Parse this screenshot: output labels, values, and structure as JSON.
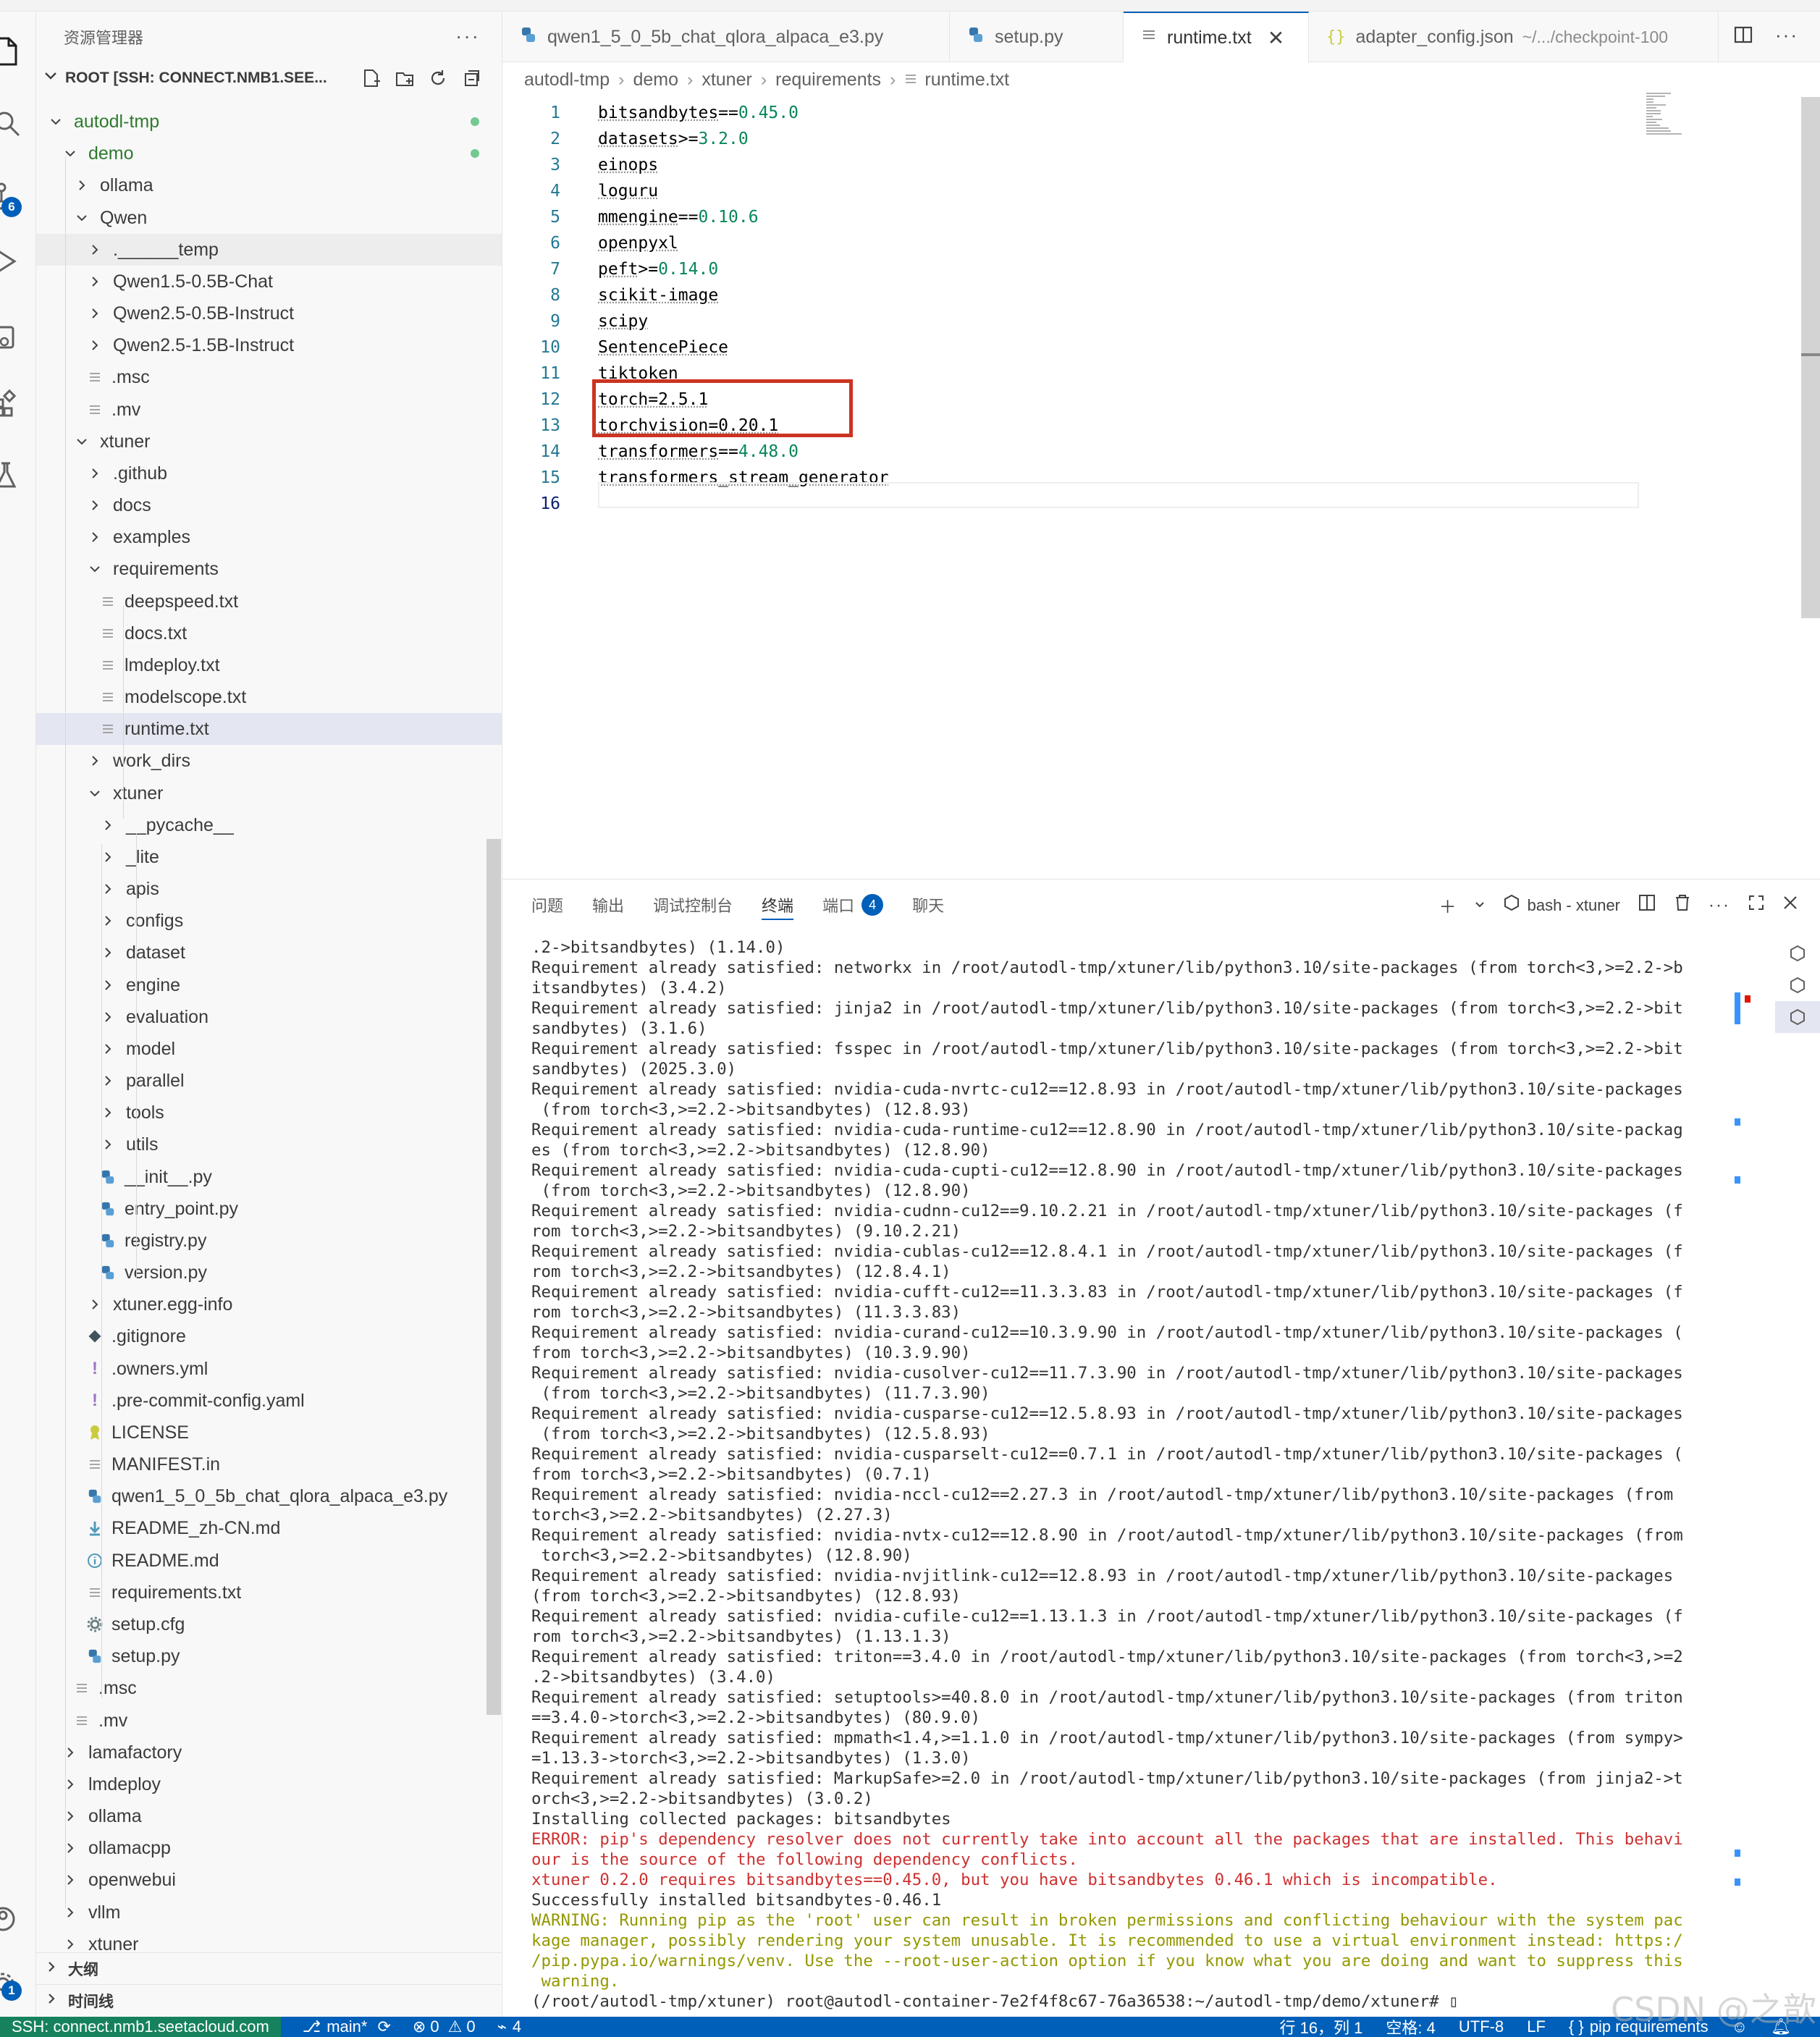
{
  "sidebar": {
    "title": "资源管理器",
    "more": "···",
    "root_label": "ROOT [SSH: CONNECT.NMB1.SEE...",
    "items": [
      {
        "label": "autodl-tmp",
        "type": "folder-open",
        "depth": 0,
        "green": true,
        "dot": true
      },
      {
        "label": "demo",
        "type": "folder-open",
        "depth": 1,
        "green": true,
        "dot": true
      },
      {
        "label": "ollama",
        "type": "folder",
        "depth": 2
      },
      {
        "label": "Qwen",
        "type": "folder-open",
        "depth": 2
      },
      {
        "label": ".______temp",
        "type": "folder",
        "depth": 3,
        "hover": true
      },
      {
        "label": "Qwen1.5-0.5B-Chat",
        "type": "folder",
        "depth": 3
      },
      {
        "label": "Qwen2.5-0.5B-Instruct",
        "type": "folder",
        "depth": 3
      },
      {
        "label": "Qwen2.5-1.5B-Instruct",
        "type": "folder",
        "depth": 3
      },
      {
        "label": ".msc",
        "type": "file",
        "depth": 3
      },
      {
        "label": ".mv",
        "type": "file",
        "depth": 3
      },
      {
        "label": "xtuner",
        "type": "folder-open",
        "depth": 2
      },
      {
        "label": ".github",
        "type": "folder",
        "depth": 3
      },
      {
        "label": "docs",
        "type": "folder",
        "depth": 3
      },
      {
        "label": "examples",
        "type": "folder",
        "depth": 3
      },
      {
        "label": "requirements",
        "type": "folder-open",
        "depth": 3
      },
      {
        "label": "deepspeed.txt",
        "type": "file",
        "depth": 4
      },
      {
        "label": "docs.txt",
        "type": "file",
        "depth": 4
      },
      {
        "label": "lmdeploy.txt",
        "type": "file",
        "depth": 4
      },
      {
        "label": "modelscope.txt",
        "type": "file",
        "depth": 4
      },
      {
        "label": "runtime.txt",
        "type": "file",
        "depth": 4,
        "active": true
      },
      {
        "label": "work_dirs",
        "type": "folder",
        "depth": 3
      },
      {
        "label": "xtuner",
        "type": "folder-open",
        "depth": 3
      },
      {
        "label": "__pycache__",
        "type": "folder",
        "depth": 4
      },
      {
        "label": "_lite",
        "type": "folder",
        "depth": 4
      },
      {
        "label": "apis",
        "type": "folder",
        "depth": 4
      },
      {
        "label": "configs",
        "type": "folder",
        "depth": 4
      },
      {
        "label": "dataset",
        "type": "folder",
        "depth": 4
      },
      {
        "label": "engine",
        "type": "folder",
        "depth": 4
      },
      {
        "label": "evaluation",
        "type": "folder",
        "depth": 4
      },
      {
        "label": "model",
        "type": "folder",
        "depth": 4
      },
      {
        "label": "parallel",
        "type": "folder",
        "depth": 4
      },
      {
        "label": "tools",
        "type": "folder",
        "depth": 4
      },
      {
        "label": "utils",
        "type": "folder",
        "depth": 4
      },
      {
        "label": "__init__.py",
        "type": "py",
        "depth": 4
      },
      {
        "label": "entry_point.py",
        "type": "py",
        "depth": 4
      },
      {
        "label": "registry.py",
        "type": "py",
        "depth": 4
      },
      {
        "label": "version.py",
        "type": "py",
        "depth": 4
      },
      {
        "label": "xtuner.egg-info",
        "type": "folder",
        "depth": 3
      },
      {
        "label": ".gitignore",
        "type": "git",
        "depth": 3
      },
      {
        "label": ".owners.yml",
        "type": "yml",
        "depth": 3
      },
      {
        "label": ".pre-commit-config.yaml",
        "type": "yml",
        "depth": 3
      },
      {
        "label": "LICENSE",
        "type": "license",
        "depth": 3
      },
      {
        "label": "MANIFEST.in",
        "type": "file",
        "depth": 3
      },
      {
        "label": "qwen1_5_0_5b_chat_qlora_alpaca_e3.py",
        "type": "py",
        "depth": 3
      },
      {
        "label": "README_zh-CN.md",
        "type": "md-down",
        "depth": 3
      },
      {
        "label": "README.md",
        "type": "md-info",
        "depth": 3
      },
      {
        "label": "requirements.txt",
        "type": "file",
        "depth": 3
      },
      {
        "label": "setup.cfg",
        "type": "gear",
        "depth": 3
      },
      {
        "label": "setup.py",
        "type": "py",
        "depth": 3
      },
      {
        "label": ".msc",
        "type": "file",
        "depth": 2
      },
      {
        "label": ".mv",
        "type": "file",
        "depth": 2
      },
      {
        "label": "lamafactory",
        "type": "folder",
        "depth": 1
      },
      {
        "label": "lmdeploy",
        "type": "folder",
        "depth": 1
      },
      {
        "label": "ollama",
        "type": "folder",
        "depth": 1
      },
      {
        "label": "ollamacpp",
        "type": "folder",
        "depth": 1
      },
      {
        "label": "openwebui",
        "type": "folder",
        "depth": 1
      },
      {
        "label": "vllm",
        "type": "folder",
        "depth": 1
      },
      {
        "label": "xtuner",
        "type": "folder",
        "depth": 1
      }
    ],
    "outline_label": "大纲",
    "timeline_label": "时间线"
  },
  "activity": {
    "scm_badge": "6",
    "accounts_badge": "1"
  },
  "tabs": [
    {
      "label": "qwen1_5_0_5b_chat_qlora_alpaca_e3.py",
      "icon": "python-icon",
      "desc": ""
    },
    {
      "label": "setup.py",
      "icon": "python-icon",
      "desc": ""
    },
    {
      "label": "runtime.txt",
      "icon": "text-file-icon",
      "desc": "",
      "active": true,
      "close": "✕"
    },
    {
      "label": "adapter_config.json",
      "icon": "json-icon",
      "desc": "~/.../checkpoint-100"
    }
  ],
  "breadcrumb": [
    "autodl-tmp",
    "demo",
    "xtuner",
    "requirements",
    "runtime.txt"
  ],
  "editor": {
    "lines": [
      {
        "n": "1",
        "pkg": "bitsandbytes",
        "op": "==",
        "ver": "0.45.0"
      },
      {
        "n": "2",
        "pkg": "datasets",
        "op": ">=",
        "ver": "3.2.0"
      },
      {
        "n": "3",
        "pkg": "einops",
        "op": "",
        "ver": ""
      },
      {
        "n": "4",
        "pkg": "loguru",
        "op": "",
        "ver": ""
      },
      {
        "n": "5",
        "pkg": "mmengine",
        "op": "==",
        "ver": "0.10.6"
      },
      {
        "n": "6",
        "pkg": "openpyxl",
        "op": "",
        "ver": ""
      },
      {
        "n": "7",
        "pkg": "peft",
        "op": ">=",
        "ver": "0.14.0"
      },
      {
        "n": "8",
        "pkg": "scikit-image",
        "op": "",
        "ver": ""
      },
      {
        "n": "9",
        "pkg": "scipy",
        "op": "",
        "ver": ""
      },
      {
        "n": "10",
        "pkg": "SentencePiece",
        "op": "",
        "ver": ""
      },
      {
        "n": "11",
        "pkg": "tiktoken",
        "op": "",
        "ver": ""
      },
      {
        "n": "12",
        "pkg": "torch=2.5.1",
        "op": "",
        "ver": ""
      },
      {
        "n": "13",
        "pkg": "torchvision=0.20.1",
        "op": "",
        "ver": ""
      },
      {
        "n": "14",
        "pkg": "transformers",
        "op": "==",
        "ver": "4.48.0"
      },
      {
        "n": "15",
        "pkg": "transformers_stream_generator",
        "op": "",
        "ver": ""
      },
      {
        "n": "16",
        "pkg": "",
        "op": "",
        "ver": ""
      }
    ]
  },
  "panel": {
    "tabs": [
      "问题",
      "输出",
      "调试控制台",
      "终端",
      "端口",
      "聊天"
    ],
    "active_tab": "终端",
    "ports_badge": "4",
    "terminal_name": "bash - xtuner",
    "terminal_lines": [
      {
        "t": ".2->bitsandbytes) (1.14.0)",
        "c": ""
      },
      {
        "t": "Requirement already satisfied: networkx in /root/autodl-tmp/xtuner/lib/python3.10/site-packages (from torch<3,>=2.2->b",
        "c": ""
      },
      {
        "t": "itsandbytes) (3.4.2)",
        "c": ""
      },
      {
        "t": "Requirement already satisfied: jinja2 in /root/autodl-tmp/xtuner/lib/python3.10/site-packages (from torch<3,>=2.2->bit",
        "c": ""
      },
      {
        "t": "sandbytes) (3.1.6)",
        "c": ""
      },
      {
        "t": "Requirement already satisfied: fsspec in /root/autodl-tmp/xtuner/lib/python3.10/site-packages (from torch<3,>=2.2->bit",
        "c": ""
      },
      {
        "t": "sandbytes) (2025.3.0)",
        "c": ""
      },
      {
        "t": "Requirement already satisfied: nvidia-cuda-nvrtc-cu12==12.8.93 in /root/autodl-tmp/xtuner/lib/python3.10/site-packages",
        "c": ""
      },
      {
        "t": " (from torch<3,>=2.2->bitsandbytes) (12.8.93)",
        "c": ""
      },
      {
        "t": "Requirement already satisfied: nvidia-cuda-runtime-cu12==12.8.90 in /root/autodl-tmp/xtuner/lib/python3.10/site-packag",
        "c": ""
      },
      {
        "t": "es (from torch<3,>=2.2->bitsandbytes) (12.8.90)",
        "c": ""
      },
      {
        "t": "Requirement already satisfied: nvidia-cuda-cupti-cu12==12.8.90 in /root/autodl-tmp/xtuner/lib/python3.10/site-packages",
        "c": ""
      },
      {
        "t": " (from torch<3,>=2.2->bitsandbytes) (12.8.90)",
        "c": ""
      },
      {
        "t": "Requirement already satisfied: nvidia-cudnn-cu12==9.10.2.21 in /root/autodl-tmp/xtuner/lib/python3.10/site-packages (f",
        "c": ""
      },
      {
        "t": "rom torch<3,>=2.2->bitsandbytes) (9.10.2.21)",
        "c": ""
      },
      {
        "t": "Requirement already satisfied: nvidia-cublas-cu12==12.8.4.1 in /root/autodl-tmp/xtuner/lib/python3.10/site-packages (f",
        "c": ""
      },
      {
        "t": "rom torch<3,>=2.2->bitsandbytes) (12.8.4.1)",
        "c": ""
      },
      {
        "t": "Requirement already satisfied: nvidia-cufft-cu12==11.3.3.83 in /root/autodl-tmp/xtuner/lib/python3.10/site-packages (f",
        "c": ""
      },
      {
        "t": "rom torch<3,>=2.2->bitsandbytes) (11.3.3.83)",
        "c": ""
      },
      {
        "t": "Requirement already satisfied: nvidia-curand-cu12==10.3.9.90 in /root/autodl-tmp/xtuner/lib/python3.10/site-packages (",
        "c": ""
      },
      {
        "t": "from torch<3,>=2.2->bitsandbytes) (10.3.9.90)",
        "c": ""
      },
      {
        "t": "Requirement already satisfied: nvidia-cusolver-cu12==11.7.3.90 in /root/autodl-tmp/xtuner/lib/python3.10/site-packages",
        "c": ""
      },
      {
        "t": " (from torch<3,>=2.2->bitsandbytes) (11.7.3.90)",
        "c": ""
      },
      {
        "t": "Requirement already satisfied: nvidia-cusparse-cu12==12.5.8.93 in /root/autodl-tmp/xtuner/lib/python3.10/site-packages",
        "c": ""
      },
      {
        "t": " (from torch<3,>=2.2->bitsandbytes) (12.5.8.93)",
        "c": ""
      },
      {
        "t": "Requirement already satisfied: nvidia-cusparselt-cu12==0.7.1 in /root/autodl-tmp/xtuner/lib/python3.10/site-packages (",
        "c": ""
      },
      {
        "t": "from torch<3,>=2.2->bitsandbytes) (0.7.1)",
        "c": ""
      },
      {
        "t": "Requirement already satisfied: nvidia-nccl-cu12==2.27.3 in /root/autodl-tmp/xtuner/lib/python3.10/site-packages (from",
        "c": ""
      },
      {
        "t": "torch<3,>=2.2->bitsandbytes) (2.27.3)",
        "c": ""
      },
      {
        "t": "Requirement already satisfied: nvidia-nvtx-cu12==12.8.90 in /root/autodl-tmp/xtuner/lib/python3.10/site-packages (from",
        "c": ""
      },
      {
        "t": " torch<3,>=2.2->bitsandbytes) (12.8.90)",
        "c": ""
      },
      {
        "t": "Requirement already satisfied: nvidia-nvjitlink-cu12==12.8.93 in /root/autodl-tmp/xtuner/lib/python3.10/site-packages",
        "c": ""
      },
      {
        "t": "(from torch<3,>=2.2->bitsandbytes) (12.8.93)",
        "c": ""
      },
      {
        "t": "Requirement already satisfied: nvidia-cufile-cu12==1.13.1.3 in /root/autodl-tmp/xtuner/lib/python3.10/site-packages (f",
        "c": ""
      },
      {
        "t": "rom torch<3,>=2.2->bitsandbytes) (1.13.1.3)",
        "c": ""
      },
      {
        "t": "Requirement already satisfied: triton==3.4.0 in /root/autodl-tmp/xtuner/lib/python3.10/site-packages (from torch<3,>=2",
        "c": ""
      },
      {
        "t": ".2->bitsandbytes) (3.4.0)",
        "c": ""
      },
      {
        "t": "Requirement already satisfied: setuptools>=40.8.0 in /root/autodl-tmp/xtuner/lib/python3.10/site-packages (from triton",
        "c": ""
      },
      {
        "t": "==3.4.0->torch<3,>=2.2->bitsandbytes) (80.9.0)",
        "c": ""
      },
      {
        "t": "Requirement already satisfied: mpmath<1.4,>=1.1.0 in /root/autodl-tmp/xtuner/lib/python3.10/site-packages (from sympy>",
        "c": ""
      },
      {
        "t": "=1.13.3->torch<3,>=2.2->bitsandbytes) (1.3.0)",
        "c": ""
      },
      {
        "t": "Requirement already satisfied: MarkupSafe>=2.0 in /root/autodl-tmp/xtuner/lib/python3.10/site-packages (from jinja2->t",
        "c": ""
      },
      {
        "t": "orch<3,>=2.2->bitsandbytes) (3.0.2)",
        "c": ""
      },
      {
        "t": "Installing collected packages: bitsandbytes",
        "c": ""
      },
      {
        "t": "ERROR: pip's dependency resolver does not currently take into account all the packages that are installed. This behavi",
        "c": "err"
      },
      {
        "t": "our is the source of the following dependency conflicts.",
        "c": "err"
      },
      {
        "t": "xtuner 0.2.0 requires bitsandbytes==0.45.0, but you have bitsandbytes 0.46.1 which is incompatible.",
        "c": "err"
      },
      {
        "t": "Successfully installed bitsandbytes-0.46.1",
        "c": ""
      },
      {
        "t": "WARNING: Running pip as the 'root' user can result in broken permissions and conflicting behaviour with the system pac",
        "c": "warn"
      },
      {
        "t": "kage manager, possibly rendering your system unusable. It is recommended to use a virtual environment instead: https:/",
        "c": "warn"
      },
      {
        "t": "/pip.pypa.io/warnings/venv. Use the --root-user-action option if you know what you are doing and want to suppress this",
        "c": "warn"
      },
      {
        "t": " warning.",
        "c": "warn"
      },
      {
        "t": "(/root/autodl-tmp/xtuner) root@autodl-container-7e2f4f8c67-76a36538:~/autodl-tmp/demo/xtuner# ▯",
        "c": ""
      }
    ]
  },
  "statusbar": {
    "remote": "SSH: connect.nmb1.seetacloud.com",
    "branch": "main*",
    "errors": "0",
    "warnings": "0",
    "ports": "4",
    "position": "行 16，列 1",
    "spaces": "空格: 4",
    "encoding": "UTF-8",
    "eol": "LF",
    "language": "pip requirements"
  },
  "watermark": "CSDN @之歆",
  "colors": {
    "accent": "#005fb8",
    "remote": "#16825d",
    "highlight_box": "#cc3322",
    "error_text": "#cd3131",
    "warning_text": "#949800",
    "version_green": "#098658"
  }
}
